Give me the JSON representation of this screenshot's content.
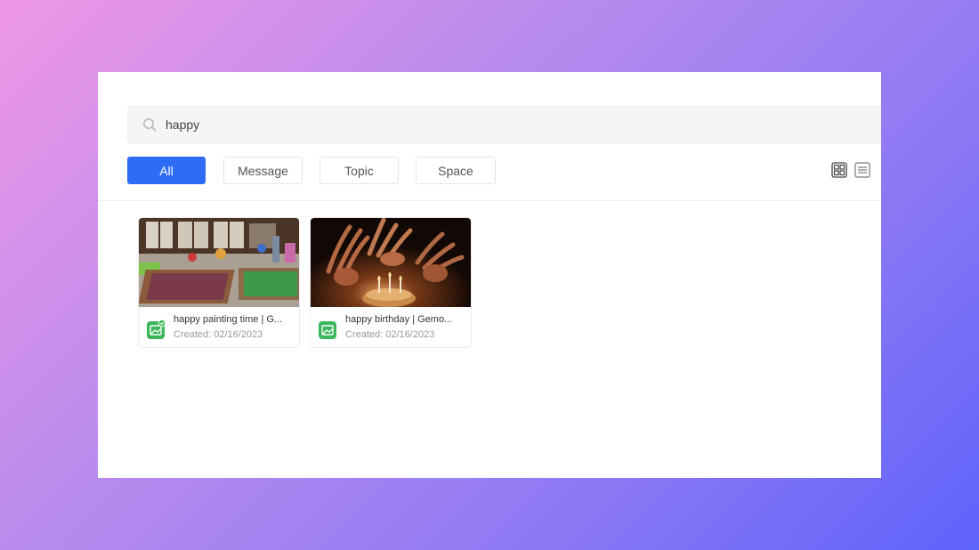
{
  "search": {
    "value": "happy"
  },
  "tabs": [
    {
      "label": "All",
      "active": true
    },
    {
      "label": "Message",
      "active": false
    },
    {
      "label": "Topic",
      "active": false
    },
    {
      "label": "Space",
      "active": false
    }
  ],
  "view_toggle": {
    "grid_icon": "grid-icon",
    "list_icon": "list-icon",
    "selected": "grid"
  },
  "results": [
    {
      "title": "happy painting time | G...",
      "created": "Created: 02/16/2023",
      "icon": "image-file-icon"
    },
    {
      "title": "happy birthday | Gemo...",
      "created": "Created: 02/16/2023",
      "icon": "image-file-icon"
    }
  ],
  "colors": {
    "accent": "#2f6cf6",
    "file_icon": "#3bb65a"
  }
}
